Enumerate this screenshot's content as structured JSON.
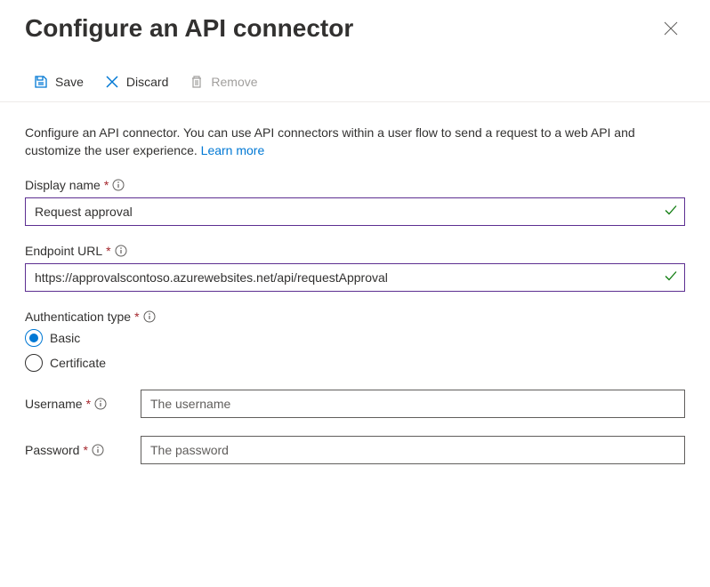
{
  "header": {
    "title": "Configure an API connector"
  },
  "toolbar": {
    "save_label": "Save",
    "discard_label": "Discard",
    "remove_label": "Remove"
  },
  "intro": {
    "text": "Configure an API connector. You can use API connectors within a user flow to send a request to a web API and customize the user experience. ",
    "link_label": "Learn more"
  },
  "fields": {
    "display_name": {
      "label": "Display name",
      "value": "Request approval"
    },
    "endpoint_url": {
      "label": "Endpoint URL",
      "value": "https://approvalscontoso.azurewebsites.net/api/requestApproval"
    },
    "auth_type": {
      "label": "Authentication type",
      "options": {
        "basic": "Basic",
        "certificate": "Certificate"
      },
      "selected": "basic"
    },
    "username": {
      "label": "Username",
      "placeholder": "The username"
    },
    "password": {
      "label": "Password",
      "placeholder": "The password"
    }
  }
}
